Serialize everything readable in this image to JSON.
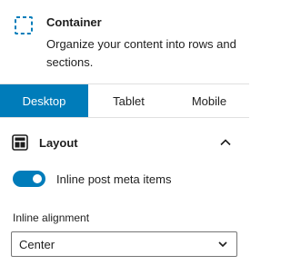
{
  "block": {
    "title": "Container",
    "description": "Organize your content into rows and sections."
  },
  "tabs": [
    {
      "label": "Desktop",
      "active": true
    },
    {
      "label": "Tablet",
      "active": false
    },
    {
      "label": "Mobile",
      "active": false
    }
  ],
  "layout_panel": {
    "title": "Layout",
    "expanded": true,
    "toggle": {
      "label": "Inline post meta items",
      "checked": true
    },
    "alignment": {
      "label": "Inline alignment",
      "value": "Center"
    }
  },
  "icons": {
    "block": "dashed-square-icon",
    "layout": "layout-icon",
    "collapse": "chevron-up-icon",
    "select": "chevron-down-icon"
  },
  "colors": {
    "accent": "#007cba",
    "text": "#1e1e1e",
    "border": "#e0e0e0"
  }
}
